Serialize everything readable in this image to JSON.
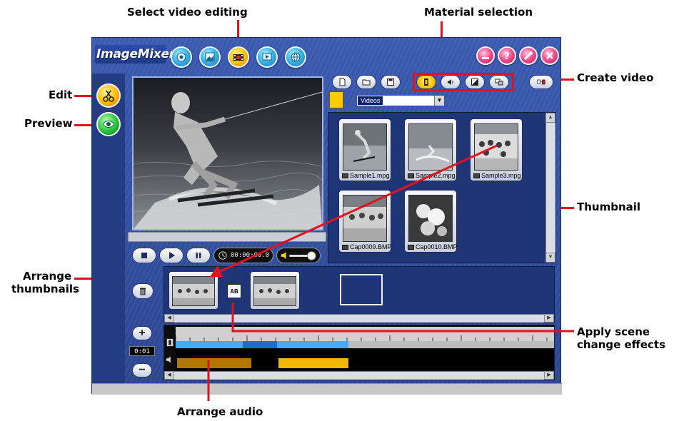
{
  "callouts": {
    "select_video_editing": "Select video editing",
    "material_selection": "Material selection",
    "create_video": "Create video",
    "edit": "Edit",
    "preview": "Preview",
    "thumbnail": "Thumbnail",
    "arrange_thumbnails_line1": "Arrange",
    "arrange_thumbnails_line2": "thumbnails",
    "apply_scene_line1": "Apply scene",
    "apply_scene_line2": "change effects",
    "arrange_audio": "Arrange audio"
  },
  "app": {
    "logo": "ImageMixer",
    "mode_buttons": [
      {
        "icon": "capture-icon",
        "active": false
      },
      {
        "icon": "album-icon",
        "active": false
      },
      {
        "icon": "video-editing-icon",
        "active": true
      },
      {
        "icon": "slideshow-icon",
        "active": false
      },
      {
        "icon": "globe-icon",
        "active": false
      }
    ],
    "system_buttons": [
      "minimize-icon",
      "help-icon",
      "tools-icon",
      "close-icon"
    ],
    "colors": {
      "window_blue": "#2f4a9a",
      "accent_yellow": "#ffc400",
      "callout_red": "#e3111b",
      "timeline_video": "#4aa8f0",
      "timeline_audio": "#f0b800"
    }
  },
  "player": {
    "timecode": "00:00:00.0"
  },
  "materials": {
    "file_tools": [
      "new-icon",
      "open-icon",
      "save-icon"
    ],
    "type_tools": [
      {
        "icon": "video-film-icon",
        "selected": true
      },
      {
        "icon": "audio-icon",
        "selected": false
      },
      {
        "icon": "transition-icon",
        "selected": false
      },
      {
        "icon": "text-overlay-icon",
        "selected": false
      }
    ],
    "create_video_icon": "create-video-icon",
    "folder": "Videos",
    "thumbnails": [
      {
        "name": "Sample1.mpg",
        "type": "video"
      },
      {
        "name": "Sample2.mpg",
        "type": "video"
      },
      {
        "name": "Sample3.mpg",
        "type": "video"
      },
      {
        "name": "Cap0009.BMP",
        "type": "image"
      },
      {
        "name": "Cap0010.BMP",
        "type": "image"
      }
    ]
  },
  "storyboard": {
    "transition_label": "AB"
  },
  "timeline": {
    "zoom_value": "0:01",
    "zoom_in": "+",
    "zoom_out": "−"
  }
}
